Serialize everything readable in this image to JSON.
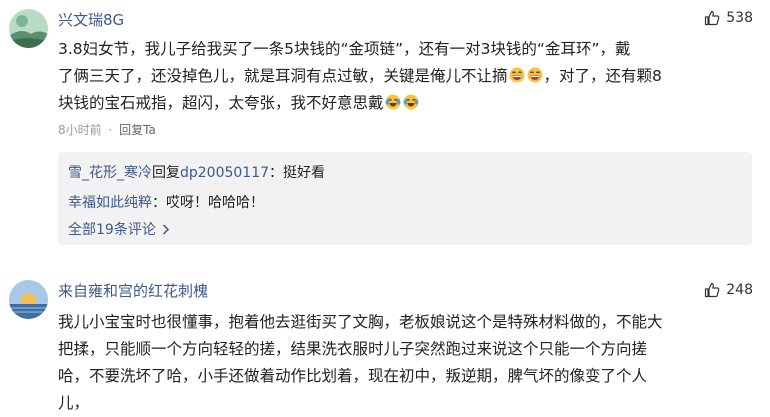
{
  "comments": [
    {
      "username": "兴文瑞8G",
      "likes": "538",
      "content": {
        "line1": "3.8妇女节，我儿子给我买了一条5块钱的“金项链”，还有一对3块钱的“金耳环”，戴",
        "line2a": "了俩三天了，还没掉色儿，就是耳洞有点过敏，关键是俺儿不让摘",
        "line2b": "，对了，还有颗8",
        "line3": "块钱的宝石戒指，超闪，太夸张，我不好意思戴"
      },
      "time": "8小时前",
      "separator": "·",
      "reply_label": "回复Ta",
      "replies": [
        {
          "name": "雪_花形_寒冷",
          "mid": "回复",
          "target": "dp20050117",
          "text": "：挺好看"
        },
        {
          "name": "幸福如此纯粹",
          "text": "：哎呀！哈哈哈！"
        }
      ],
      "more_label": "全部19条评论",
      "more_icon": "chevron-right",
      "emoji_1": "grinning-sweat",
      "emoji_2": "laughing-tears"
    },
    {
      "username": "来自雍和宫的红花刺槐",
      "likes": "248",
      "content": {
        "line1": "我儿小宝宝时也很懂事，抱着他去逛街买了文胸，老板娘说这个是特殊材料做的，不能大",
        "line2": "把揉，只能顺一个方向轻轻的搓，结果洗衣服时儿子突然跑过来说这个只能一个方向搓",
        "line3": "哈，不要洗坏了哈，小手还做着动作比划着，现在初中，叛逆期，脾气坏的像变了个人",
        "line4": "儿，"
      }
    }
  ]
}
